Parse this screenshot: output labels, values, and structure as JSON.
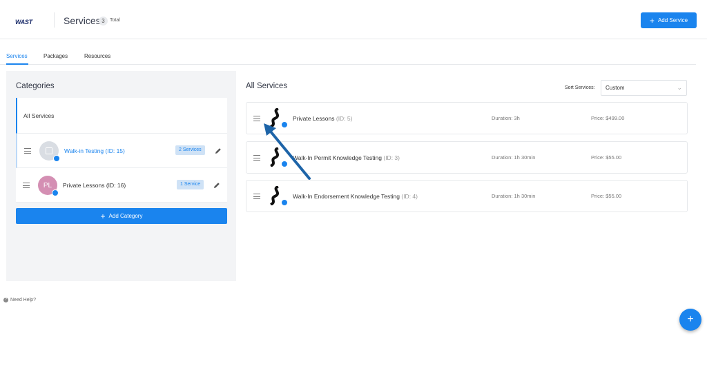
{
  "header": {
    "logo_text": "WAST",
    "title": "Services",
    "total_count": "3",
    "total_label": "Total",
    "add_service_label": "Add Service"
  },
  "tabs": [
    {
      "label": "Services",
      "active": true
    },
    {
      "label": "Packages",
      "active": false
    },
    {
      "label": "Resources",
      "active": false
    }
  ],
  "categories": {
    "title": "Categories",
    "all_label": "All Services",
    "items": [
      {
        "name": "Walk-in Testing (ID: 15)",
        "count": "2 Services",
        "avatar": ""
      },
      {
        "name": "Private Lessons (ID: 16)",
        "count": "1 Service",
        "avatar": "PL"
      }
    ],
    "add_label": "Add Category"
  },
  "services": {
    "title": "All Services",
    "sort_label": "Sort Services:",
    "sort_value": "Custom",
    "items": [
      {
        "name": "Private Lessons",
        "id": "(ID: 5)",
        "duration": "Duration: 3h",
        "price": "Price: $499.00"
      },
      {
        "name": "Walk-In Permit Knowledge Testing",
        "id": "(ID: 3)",
        "duration": "Duration: 1h 30min",
        "price": "Price: $55.00"
      },
      {
        "name": "Walk-In Endorsement Knowledge Testing",
        "id": "(ID: 4)",
        "duration": "Duration: 1h 30min",
        "price": "Price: $55.00"
      }
    ]
  },
  "help_label": "Need Help?",
  "colors": {
    "accent": "#1a84ee",
    "annotation_arrow": "#1d64a8"
  }
}
